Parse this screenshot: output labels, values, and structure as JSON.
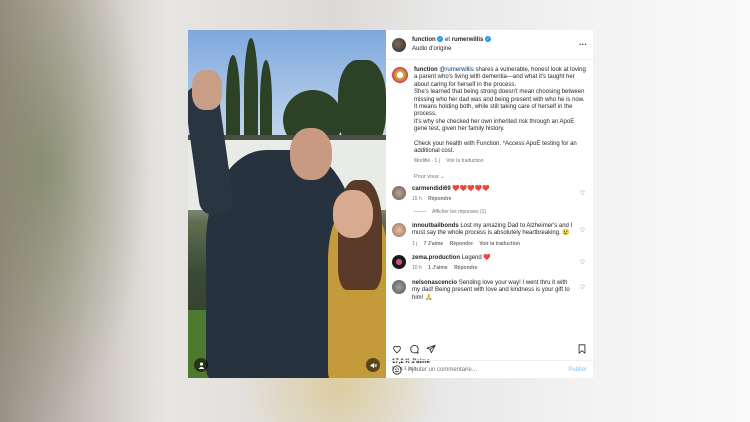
{
  "header": {
    "account1": "function",
    "connector": "et",
    "account2": "rumerwillis",
    "audio": "Audio d'origine"
  },
  "caption": {
    "author": "function",
    "mention": "@rumerwillis",
    "line1": " shares a vulnerable, honest look at loving a parent who's living with dementia—and what it's taught her about caring for herself in the process.",
    "line2": "She's learned that being strong doesn't mean choosing between missing who her dad was and being present with who he is now. It means holding both, while still taking care of herself in the process.",
    "line3": "It's why she checked her own inherited risk through an ApoE gene test, given her family history.",
    "line4": "Check your health with Function. *Access ApoE testing for an additional cost.",
    "edited": "Modifié · 1 j",
    "translate": "Voir la traduction"
  },
  "sort_label": "Pour vous",
  "comments": [
    {
      "user": "carmendidi69",
      "text": "❤️❤️❤️❤️❤️",
      "time": "15 h",
      "reply": "Répondre",
      "likes": "",
      "translate": ""
    },
    {
      "user": "innoutbailbonds",
      "text": "Lost my amazing Dad to Alzheimer's and I must say the whole process is absolutely heartbreaking. 😢",
      "time": "1 j",
      "likes": "7 J'aime",
      "reply": "Répondre",
      "translate": "Voir la traduction"
    },
    {
      "user": "zema.production",
      "text": "Legend ❤️",
      "time": "10 h",
      "likes": "1 J'aime",
      "reply": "Répondre",
      "translate": ""
    },
    {
      "user": "nelsonascencio",
      "text": "Sending love your way! I went thru it with my dad! Being present with love and kindness is your gift to him! 🙏",
      "time": "",
      "likes": "",
      "reply": "",
      "translate": ""
    }
  ],
  "replies_link": "Afficher les réponses (1)",
  "stats": {
    "likes": "17,2 K J'aime",
    "ago": "Il y a 1 jour"
  },
  "add_comment": {
    "placeholder": "Ajouter un commentaire…",
    "post": "Publier"
  },
  "icons": {
    "more": "more-icon",
    "like": "heart-icon",
    "comment": "comment-icon",
    "share": "share-icon",
    "save": "bookmark-icon",
    "emoji": "emoji-icon",
    "user_tag": "user-tag-icon",
    "mute": "mute-icon"
  },
  "colors": {
    "verified": "#1d9bf0",
    "heart": "#e0245e",
    "link": "#00376b",
    "muted": "#737373",
    "post": "#85c4f5"
  }
}
